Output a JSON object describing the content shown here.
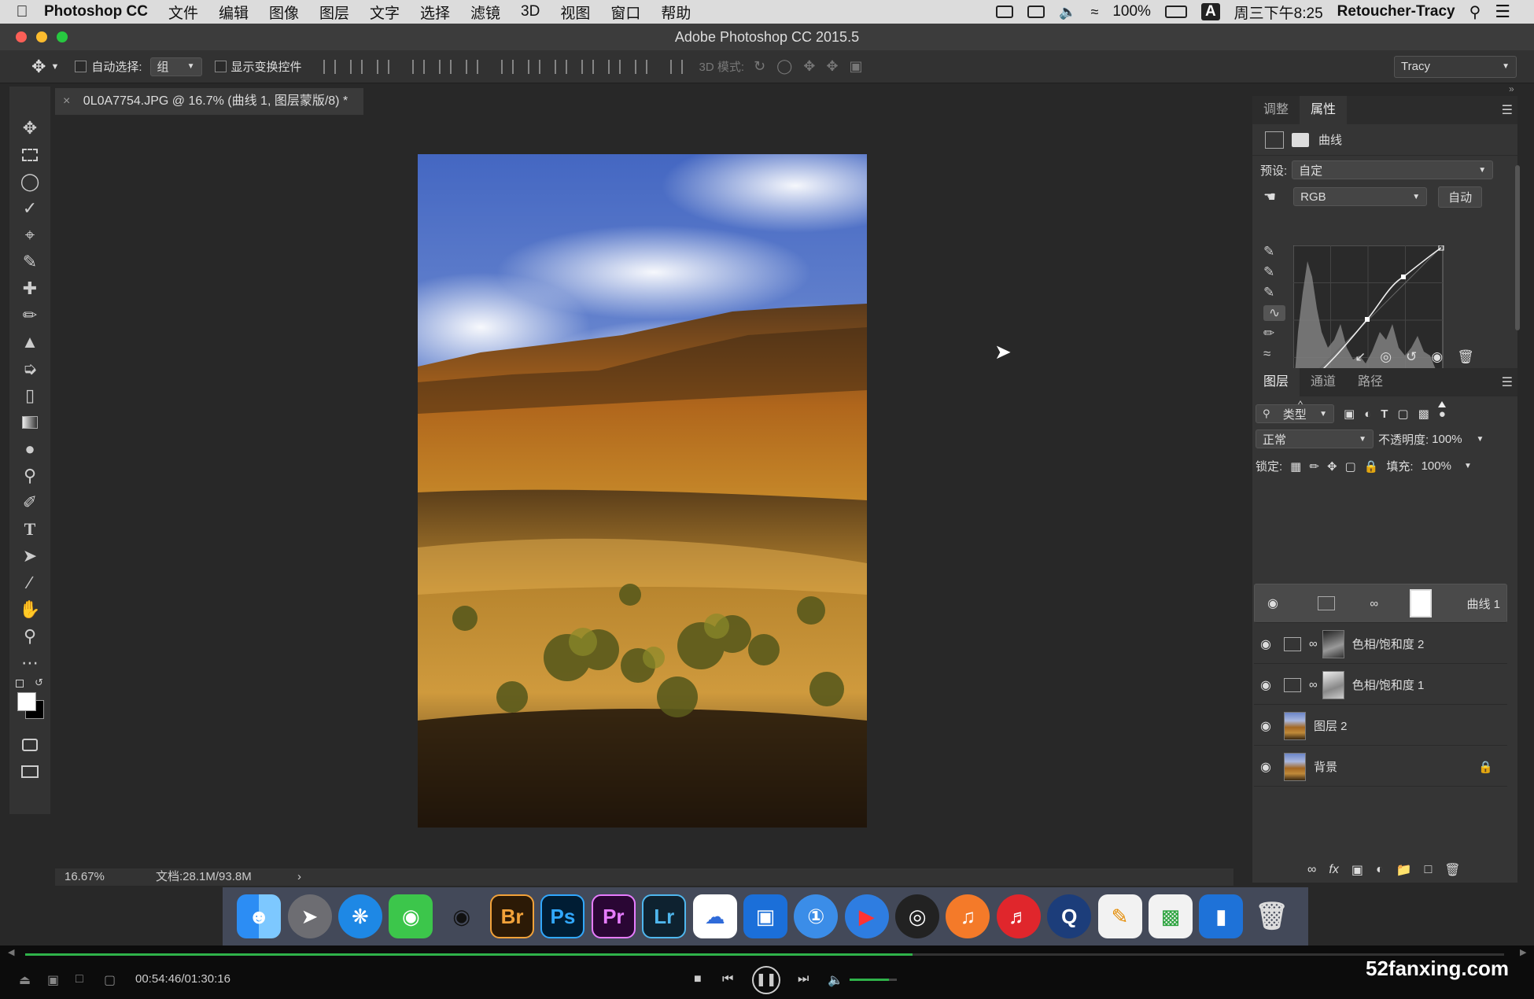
{
  "menubar": {
    "app_name": "Photoshop CC",
    "menus": [
      "文件",
      "编辑",
      "图像",
      "图层",
      "文字",
      "选择",
      "滤镜",
      "3D",
      "视图",
      "窗口",
      "帮助"
    ],
    "battery": "100%",
    "clock": "周三下午8:25",
    "user": "Retoucher-Tracy",
    "input_method": "A"
  },
  "window": {
    "title": "Adobe Photoshop CC 2015.5"
  },
  "options": {
    "auto_select_label": "自动选择:",
    "auto_select_value": "组",
    "show_transform_label": "显示变换控件",
    "mode3d_label": "3D 模式:",
    "workspace": "Tracy"
  },
  "document": {
    "tab_title": "0L0A7754.JPG @ 16.7% (曲线 1, 图层蒙版/8) *",
    "zoom": "16.67%",
    "doc_size": "文档:28.1M/93.8M"
  },
  "properties": {
    "tabs": [
      "调整",
      "属性"
    ],
    "active_tab": "属性",
    "panel_label": "曲线",
    "preset_label": "预设:",
    "preset_value": "自定",
    "channel": "RGB",
    "auto_button": "自动"
  },
  "layers_panel": {
    "tabs": [
      "图层",
      "通道",
      "路径"
    ],
    "filter_kind": "类型",
    "blend_mode": "正常",
    "opacity_label": "不透明度:",
    "opacity_value": "100%",
    "lock_label": "锁定:",
    "fill_label": "填充:",
    "fill_value": "100%",
    "layers": [
      {
        "name": "曲线 1"
      },
      {
        "name": "色相/饱和度 2"
      },
      {
        "name": "色相/饱和度 1"
      },
      {
        "name": "图层 2"
      },
      {
        "name": "背景"
      }
    ]
  },
  "dock": {
    "labels": [
      "Br",
      "Ps",
      "Pr",
      "Lr"
    ]
  },
  "player": {
    "timecode": "00:54:46/01:30:16",
    "watermark": "52fanxing.com",
    "progress": 0.6
  },
  "colors": {
    "ps_blue": "#31a8ff",
    "pr_purple": "#e77cff",
    "br_orange": "#f2a23a",
    "lr_blue": "#4fb7ee"
  }
}
